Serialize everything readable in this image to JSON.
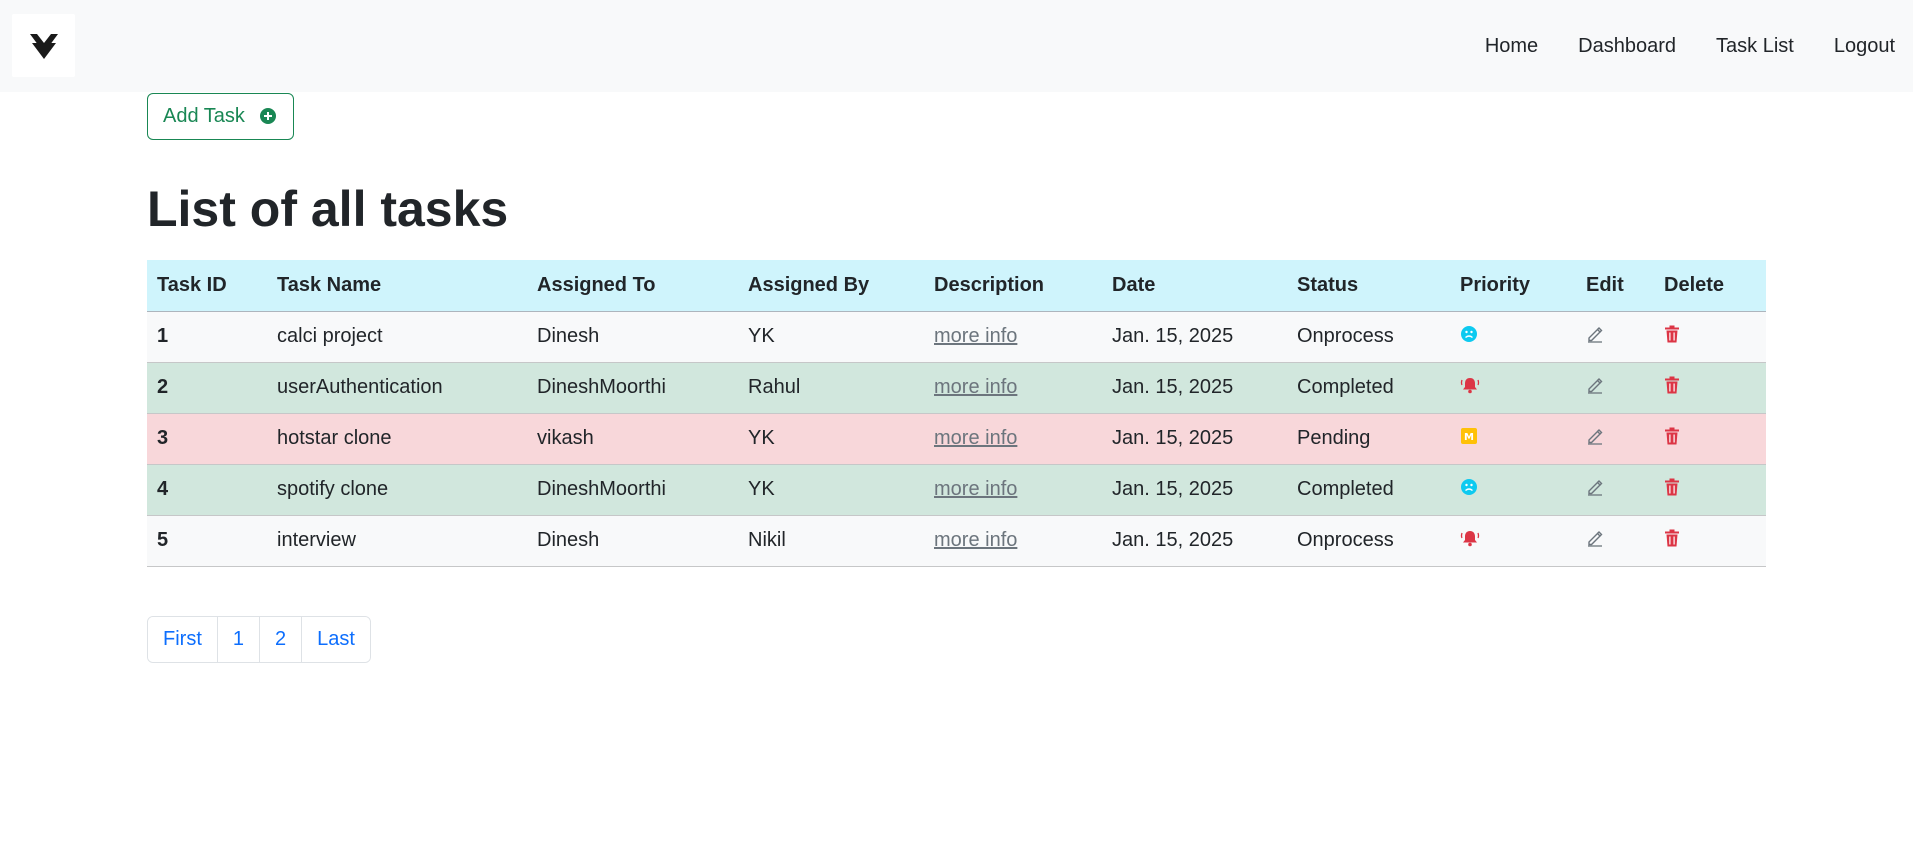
{
  "nav": {
    "logo": "logo-icon",
    "links": [
      "Home",
      "Dashboard",
      "Task List",
      "Logout"
    ]
  },
  "add_task": {
    "label": "Add Task",
    "icon": "plus-circle-icon",
    "color": "#198754"
  },
  "page_title": "List of all tasks",
  "table": {
    "headers": [
      "Task ID",
      "Task Name",
      "Assigned To",
      "Assigned By",
      "Description",
      "Date",
      "Status",
      "Priority",
      "Edit",
      "Delete"
    ],
    "rows": [
      {
        "id": "1",
        "name": "calci project",
        "assigned_to": "Dinesh",
        "assigned_by": "YK",
        "description": "more info",
        "date": "Jan. 15, 2025",
        "status": "Onprocess",
        "priority_icon": "low-priority-face-icon",
        "row_style": "light"
      },
      {
        "id": "2",
        "name": "userAuthentication",
        "assigned_to": "DineshMoorthi",
        "assigned_by": "Rahul",
        "description": "more info",
        "date": "Jan. 15, 2025",
        "status": "Completed",
        "priority_icon": "high-priority-bell-icon",
        "row_style": "success"
      },
      {
        "id": "3",
        "name": "hotstar clone",
        "assigned_to": "vikash",
        "assigned_by": "YK",
        "description": "more info",
        "date": "Jan. 15, 2025",
        "status": "Pending",
        "priority_icon": "medium-priority-m-icon",
        "row_style": "danger"
      },
      {
        "id": "4",
        "name": "spotify clone",
        "assigned_to": "DineshMoorthi",
        "assigned_by": "YK",
        "description": "more info",
        "date": "Jan. 15, 2025",
        "status": "Completed",
        "priority_icon": "low-priority-face-icon",
        "row_style": "success"
      },
      {
        "id": "5",
        "name": "interview",
        "assigned_to": "Dinesh",
        "assigned_by": "Nikil",
        "description": "more info",
        "date": "Jan. 15, 2025",
        "status": "Onprocess",
        "priority_icon": "high-priority-bell-icon",
        "row_style": "light"
      }
    ],
    "edit_icon": "pencil-icon",
    "delete_icon": "trash-icon"
  },
  "pagination": [
    "First",
    "1",
    "2",
    "Last"
  ],
  "colors": {
    "header_bg": "#cff4fc",
    "success_row": "#d1e7dd",
    "danger_row": "#f8d7da",
    "light_row": "#f8f9fa",
    "link_blue": "#0d6efd",
    "delete_red": "#dc3545",
    "low_priority": "#0dcaf0",
    "medium_priority": "#ffc107"
  }
}
